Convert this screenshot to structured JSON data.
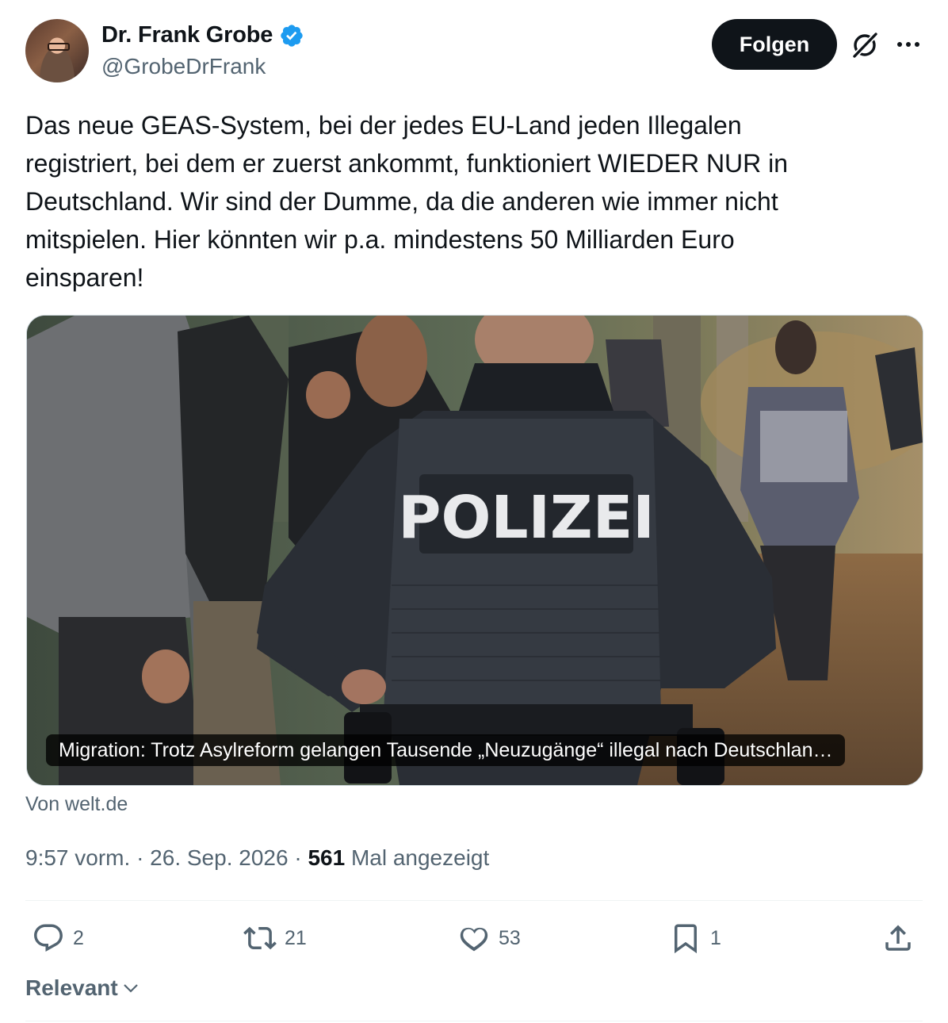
{
  "author": {
    "name": "Dr. Frank Grobe",
    "handle": "@GrobeDrFrank",
    "verified": true
  },
  "follow_label": "Folgen",
  "tweet_text": "Das neue GEAS-System, bei der jedes EU-Land jeden Illegalen\nregistriert, bei dem er zuerst ankommt, funktioniert WIEDER NUR in\nDeutschland. Wir sind der Dumme, da die anderen wie immer nicht\nmitspielen. Hier könnten wir p.a. mindestens 50 Milliarden Euro\neinsparen!",
  "card": {
    "caption": "Migration: Trotz Asylreform gelangen Tausende „Neuzugänge“ illegal nach Deutschlan…",
    "image_text": "POLIZEI",
    "source": "Von welt.de"
  },
  "meta": {
    "time": "9:57 vorm.",
    "sep1": "·",
    "date": "26. Sep. 2026",
    "sep2": "·",
    "views": "561",
    "views_label": "Mal angezeigt"
  },
  "actions": {
    "replies": "2",
    "reposts": "21",
    "likes": "53",
    "bookmarks": "1"
  },
  "sort_label": "Relevant",
  "colors": {
    "verified": "#1d9bf0",
    "secondary_text": "#536471",
    "primary_text": "#0f1419",
    "border": "#cfd9de"
  }
}
